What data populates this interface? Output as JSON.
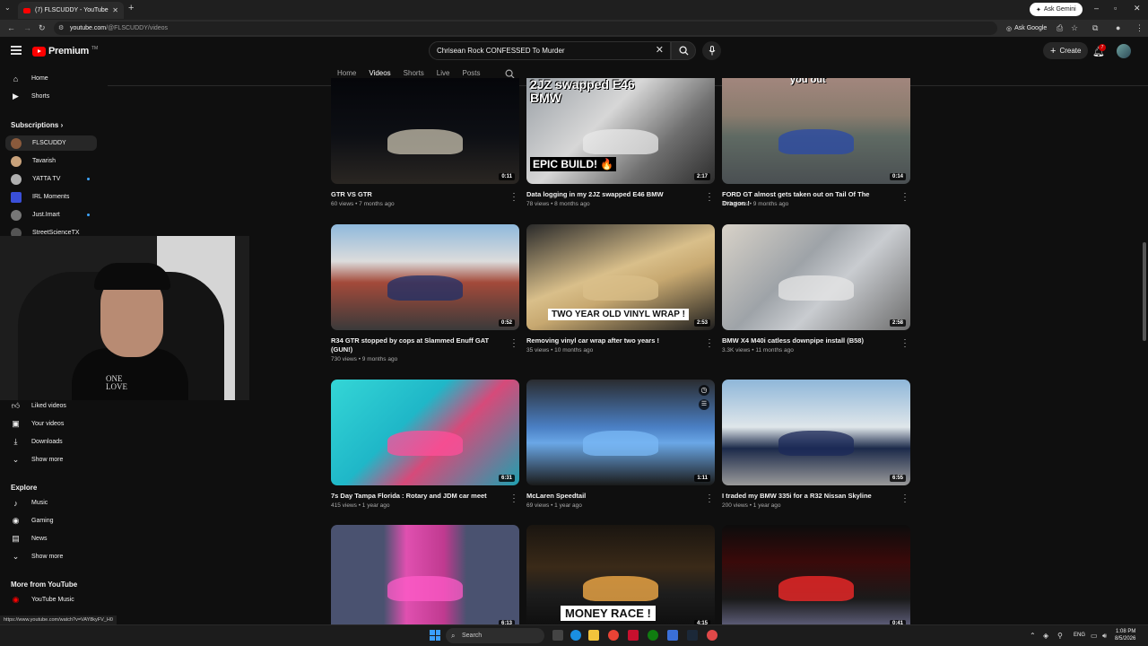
{
  "browser": {
    "tab_title": "(7) FLSCUDDY - YouTube",
    "url_host": "youtube.com",
    "url_path": "/@FLSCUDDY/videos",
    "ask_gemini": "Ask Gemini",
    "ask_google": "Ask Google",
    "status_url": "https://www.youtube.com/watch?v=VAY8kyFV_H0"
  },
  "header": {
    "logo_text": "Premium",
    "logo_tm": "TM",
    "search_value": "Chrisean Rock CONFESSED To Murder",
    "create_label": "Create",
    "notification_count": "7"
  },
  "channel_tabs": [
    {
      "label": "Home",
      "active": false
    },
    {
      "label": "Videos",
      "active": true
    },
    {
      "label": "Shorts",
      "active": false
    },
    {
      "label": "Live",
      "active": false
    },
    {
      "label": "Posts",
      "active": false
    }
  ],
  "sidebar": {
    "top_items": [
      {
        "label": "Home",
        "icon": "home-icon"
      },
      {
        "label": "Shorts",
        "icon": "shorts-icon"
      }
    ],
    "subscriptions_label": "Subscriptions",
    "subscriptions": [
      {
        "label": "FLSCUDDY",
        "active": true,
        "color": "#8a5a3c",
        "live": false
      },
      {
        "label": "Tavarish",
        "active": false,
        "color": "#c9a27b",
        "live": false
      },
      {
        "label": "YATTA TV",
        "active": false,
        "color": "#b0b0b0",
        "live": true
      },
      {
        "label": "IRL Moments",
        "active": false,
        "color": "#3a4fd8",
        "live": false
      },
      {
        "label": "Just.Imart",
        "active": false,
        "color": "#777777",
        "live": true
      },
      {
        "label": "StreetScienceTX",
        "active": false,
        "color": "#555555",
        "live": false
      }
    ],
    "you_items": [
      {
        "label": "Liked videos",
        "icon": "thumbs-up-icon"
      },
      {
        "label": "Your videos",
        "icon": "your-videos-icon"
      },
      {
        "label": "Downloads",
        "icon": "download-icon"
      },
      {
        "label": "Show more",
        "icon": "chevron-down-icon"
      }
    ],
    "explore_label": "Explore",
    "explore_items": [
      {
        "label": "Music",
        "icon": "music-icon"
      },
      {
        "label": "Gaming",
        "icon": "gaming-icon"
      },
      {
        "label": "News",
        "icon": "news-icon"
      },
      {
        "label": "Show more",
        "icon": "chevron-down-icon"
      }
    ],
    "more_label": "More from YouTube",
    "more_items": [
      {
        "label": "YouTube Music",
        "icon": "youtube-music-icon"
      }
    ]
  },
  "webcam": {
    "shirt_text_1": "ONE",
    "shirt_text_2": "LOVE"
  },
  "videos": [
    {
      "title": "GTR VS GTR",
      "meta": "60 views • 7 months ago",
      "duration": "0:11",
      "thumb_text": "",
      "bg": "linear-gradient(180deg,#05060a 0%,#0d0f14 55%,#2a2622 100%)",
      "accent": "#c9c3b0"
    },
    {
      "title": "Data logging in my 2JZ swapped E46 BMW",
      "meta": "78 views • 8 months ago",
      "duration": "2:17",
      "thumb_text": "2JZ swapped E46 BMW",
      "thumb_text2": "EPIC BUILD! 🔥",
      "bg": "linear-gradient(135deg,#9aa0a6 0%,#d7d7d7 40%,#6e6e6e 70%,#2c2c2c 100%)",
      "accent": "#e8e8e8"
    },
    {
      "title": "FORD GT almost gets taken out on Tail Of The Dragon !",
      "meta": "840 views • 9 months ago",
      "duration": "0:14",
      "thumb_text": "you out",
      "bg": "linear-gradient(180deg,#a2867d 0%,#8a7c6e 35%,#5f6a63 55%,#4a4f52 100%)",
      "accent": "#2a4aa8"
    },
    {
      "title": "R34 GTR stopped by cops at Slammed Enuff GAT (GUN!)",
      "meta": "730 views • 9 months ago",
      "duration": "0:52",
      "thumb_text": "",
      "bg": "linear-gradient(180deg,#8fb9dc 0%,#dcdcdc 35%,#a34a3a 55%,#3a3a3a 100%)",
      "accent": "#1c2f6a"
    },
    {
      "title": "Removing vinyl car wrap after two years !",
      "meta": "35 views • 10 months ago",
      "duration": "2:53",
      "thumb_text": "TWO YEAR OLD VINYL WRAP !",
      "bg": "linear-gradient(160deg,#2a2a2a 0%,#d9bf8a 45%,#c7a870 60%,#1e1e1e 100%)",
      "accent": "#d9bf8a"
    },
    {
      "title": "BMW X4 M40i catless downpipe install (B58)",
      "meta": "3.3K views • 11 months ago",
      "duration": "2:58",
      "thumb_text": "",
      "bg": "linear-gradient(135deg,#d8d2c8 0%,#9ea3a8 40%,#c9ccd0 60%,#6d6d6d 100%)",
      "accent": "#e6e6e6"
    },
    {
      "title": "7s Day Tampa Florida : Rotary and JDM car meet",
      "meta": "415 views • 1 year ago",
      "duration": "6:31",
      "thumb_text": "",
      "bg": "linear-gradient(135deg,#34d6d6 0%,#1fb7c8 40%,#d64a7a 60%,#1fa0b0 100%)",
      "accent": "#ff4f9a"
    },
    {
      "title": "McLaren Speedtail",
      "meta": "69 views • 1 year ago",
      "duration": "1:11",
      "thumb_text": "",
      "bg": "linear-gradient(180deg,#2a2c30 0%,#4a7fc4 45%,#6aa7e6 60%,#1a1a1a 100%)",
      "accent": "#7ab8f5"
    },
    {
      "title": "I traded my BMW 335i for a R32 Nissan Skyline",
      "meta": "200 views • 1 year ago",
      "duration": "6:55",
      "thumb_text": "",
      "bg": "linear-gradient(180deg,#8fb7d9 0%,#dfe6ea 45%,#1c2a4a 65%,#9a9a9a 100%)",
      "accent": "#1c2a5a"
    },
    {
      "title": "",
      "meta": "",
      "duration": "6:13",
      "thumb_text": "",
      "bg": "linear-gradient(90deg,#4a5270 0%,#4a5270 28%,#e050b0 40%,#c03a90 60%,#4a5270 72%,#4a5270 100%)",
      "accent": "#ff5bc8"
    },
    {
      "title": "",
      "meta": "",
      "duration": "4:15",
      "thumb_text": "MONEY RACE !",
      "bg": "linear-gradient(180deg,#1a1510 0%,#3a2a18 40%,#1d1d1d 65%,#0c0c0c 100%)",
      "accent": "#ffb34a"
    },
    {
      "title": "",
      "meta": "",
      "duration": "0:41",
      "thumb_text": "",
      "bg": "linear-gradient(180deg,#0c0c0c 0%,#3a0a0a 35%,#1a1a1a 70%,#6a6a8a 100%)",
      "accent": "#ff2a2a"
    }
  ],
  "taskbar": {
    "search_placeholder": "Search",
    "lang": "ENG",
    "time": "1:08 PM",
    "date": "8/5/2026"
  }
}
